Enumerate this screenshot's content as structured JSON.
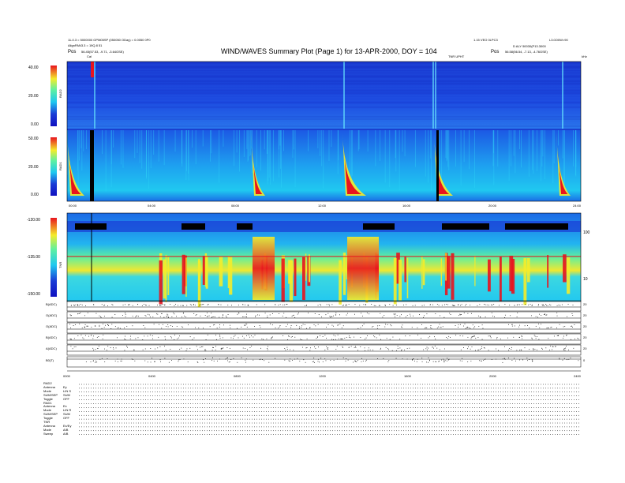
{
  "header": {
    "title": "WIND/WAVES Summary Plot (Page 1) for 13-APR-2000, DOY = 104",
    "left_line1": "11-0.3 = 5000000 GPM05SP (050050 ODay) = 0.0050 0P0",
    "left_line2": "AlignPAN3.3 = 19Q.8 51",
    "left_pos_label": "Pos",
    "left_pos_value": "56.45(57.53, -9.71, -3.64GSE)",
    "right_line1": "1.15 VEO 0LPC3",
    "right_line1b": "L3.0O0W=90",
    "right_line2": "D ALY 50030(P13.3000",
    "right_pos_label": "Pos",
    "right_pos_value": "56.58(56.54, -7.13, -4.76GSE)",
    "tnr_tag": "TNR UPHT",
    "cal_tag": "Cal",
    "unit_tag": "kHz"
  },
  "chart_data": [
    {
      "type": "heatmap",
      "name": "RAD2",
      "ylabel": "RAD2",
      "ylim": [
        0,
        40
      ],
      "yticks": [
        "40.00",
        "20.00",
        "0.00"
      ]
    },
    {
      "type": "heatmap",
      "name": "RAD1",
      "ylabel": "RAD1",
      "ylim": [
        0,
        50
      ],
      "yticks": [
        "50.00",
        "20.00",
        "0.00"
      ],
      "xticks": [
        "00:00",
        "04:00",
        "08:00",
        "12:00",
        "16:00",
        "20:00",
        "24:00"
      ]
    },
    {
      "type": "heatmap",
      "name": "TNR",
      "ylabel": "TNR",
      "ylim": [
        -150,
        -120
      ],
      "yticks": [
        "-120.00",
        "-135.00",
        "-150.00"
      ],
      "right_ticks": [
        "100",
        "10"
      ],
      "xticks": [
        "00:00",
        "04:00",
        "08:00",
        "12:00",
        "16:00",
        "20:00",
        "24:00"
      ]
    },
    {
      "type": "scatter",
      "name": "parameters",
      "rows": [
        {
          "label": "B(ADC)",
          "right": "20"
        },
        {
          "label": "O(ADC)",
          "right": "20"
        },
        {
          "label": "O(ADC)",
          "right": "20"
        },
        {
          "label": "B(ADC)",
          "right": "20"
        },
        {
          "label": "A(ADC)",
          "right": "20"
        },
        {
          "label": "B0(T)",
          "right": "0"
        }
      ],
      "xticks": [
        "0000",
        "0400",
        "0800",
        "1200",
        "1600",
        "2000",
        "2400"
      ]
    }
  ],
  "footer": {
    "rows": [
      {
        "label": "RAD2",
        "value": ""
      },
      {
        "label": "Antenna",
        "value": "Ey"
      },
      {
        "label": "Mode",
        "value": "LIN S"
      },
      {
        "label": "SUM/SEP",
        "value": "SUM"
      },
      {
        "label": "Toggle",
        "value": "OFF"
      },
      {
        "label": "RAD1",
        "value": ""
      },
      {
        "label": "Antenna",
        "value": "Ex"
      },
      {
        "label": "Mode",
        "value": "LIN R"
      },
      {
        "label": "SUM/SEP",
        "value": "SUM"
      },
      {
        "label": "Toggle",
        "value": "OFF"
      },
      {
        "label": "TNR",
        "value": ""
      },
      {
        "label": "Antenna",
        "value": "Ex/Ey"
      },
      {
        "label": "Mode",
        "value": "A/B"
      },
      {
        "label": "Sweep",
        "value": "A/B"
      }
    ]
  },
  "colors": {
    "background_blue": "#1a3cd6",
    "cyan": "#1ec8f0",
    "yellow": "#f4ec2a",
    "red": "#e8141e",
    "black": "#000000"
  }
}
